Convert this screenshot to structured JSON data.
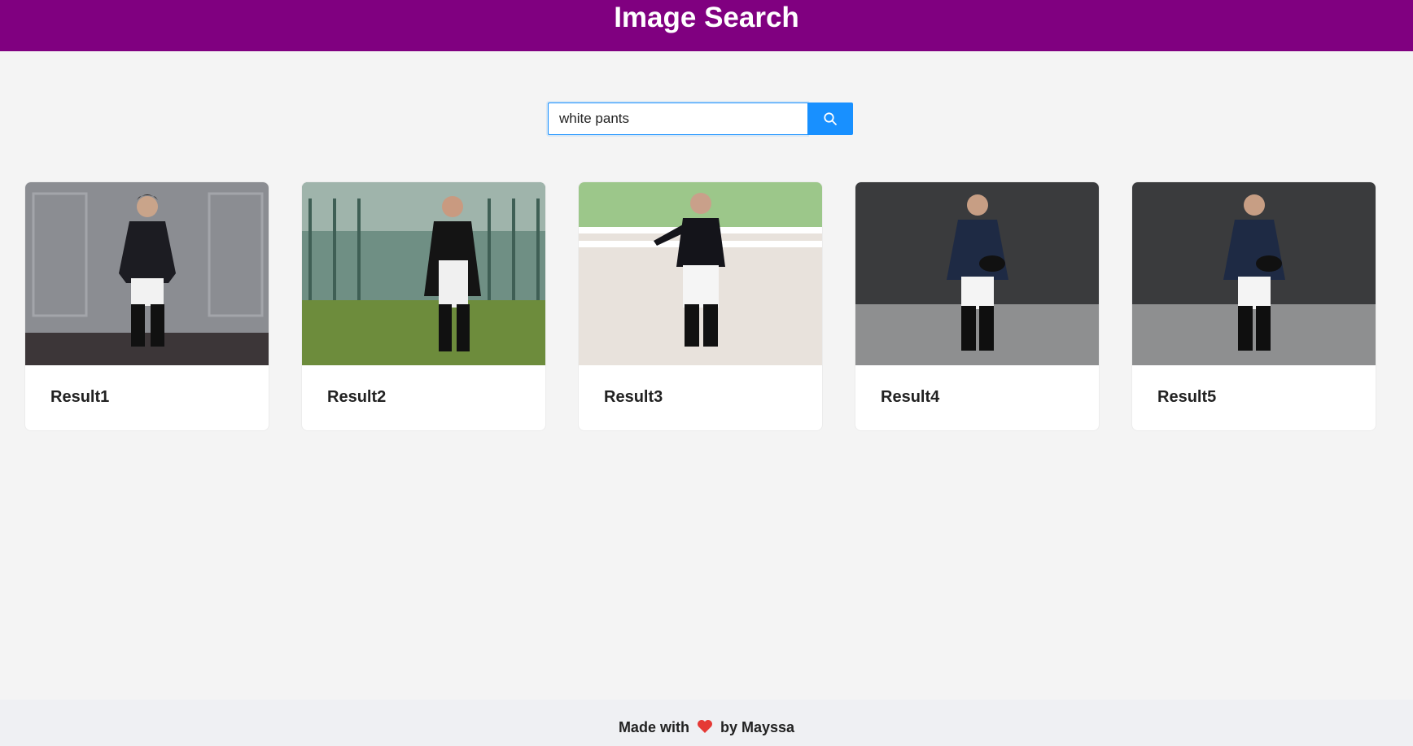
{
  "header": {
    "title": "Image Search"
  },
  "search": {
    "value": "white pants",
    "button_icon": "search-icon",
    "accent_color": "#1890ff"
  },
  "results": [
    {
      "title": "Result1",
      "image": "man in black jacket, white breeches and riding boots against grey panelled wall"
    },
    {
      "title": "Result2",
      "image": "rider in black tailcoat, white breeches standing on grass by fence"
    },
    {
      "title": "Result3",
      "image": "man in black riding jacket and white breeches in outdoor arena"
    },
    {
      "title": "Result4",
      "image": "man in navy riding jacket holding helmet, dark studio background"
    },
    {
      "title": "Result5",
      "image": "man in navy riding jacket holding helmet, dark studio background"
    }
  ],
  "footer": {
    "prefix": "Made with",
    "icon": "heart-icon",
    "suffix": "by Mayssa"
  },
  "colors": {
    "header_bg": "#800080",
    "page_bg": "#f4f4f4",
    "footer_bg": "#eff0f3",
    "heart": "#e53935"
  }
}
